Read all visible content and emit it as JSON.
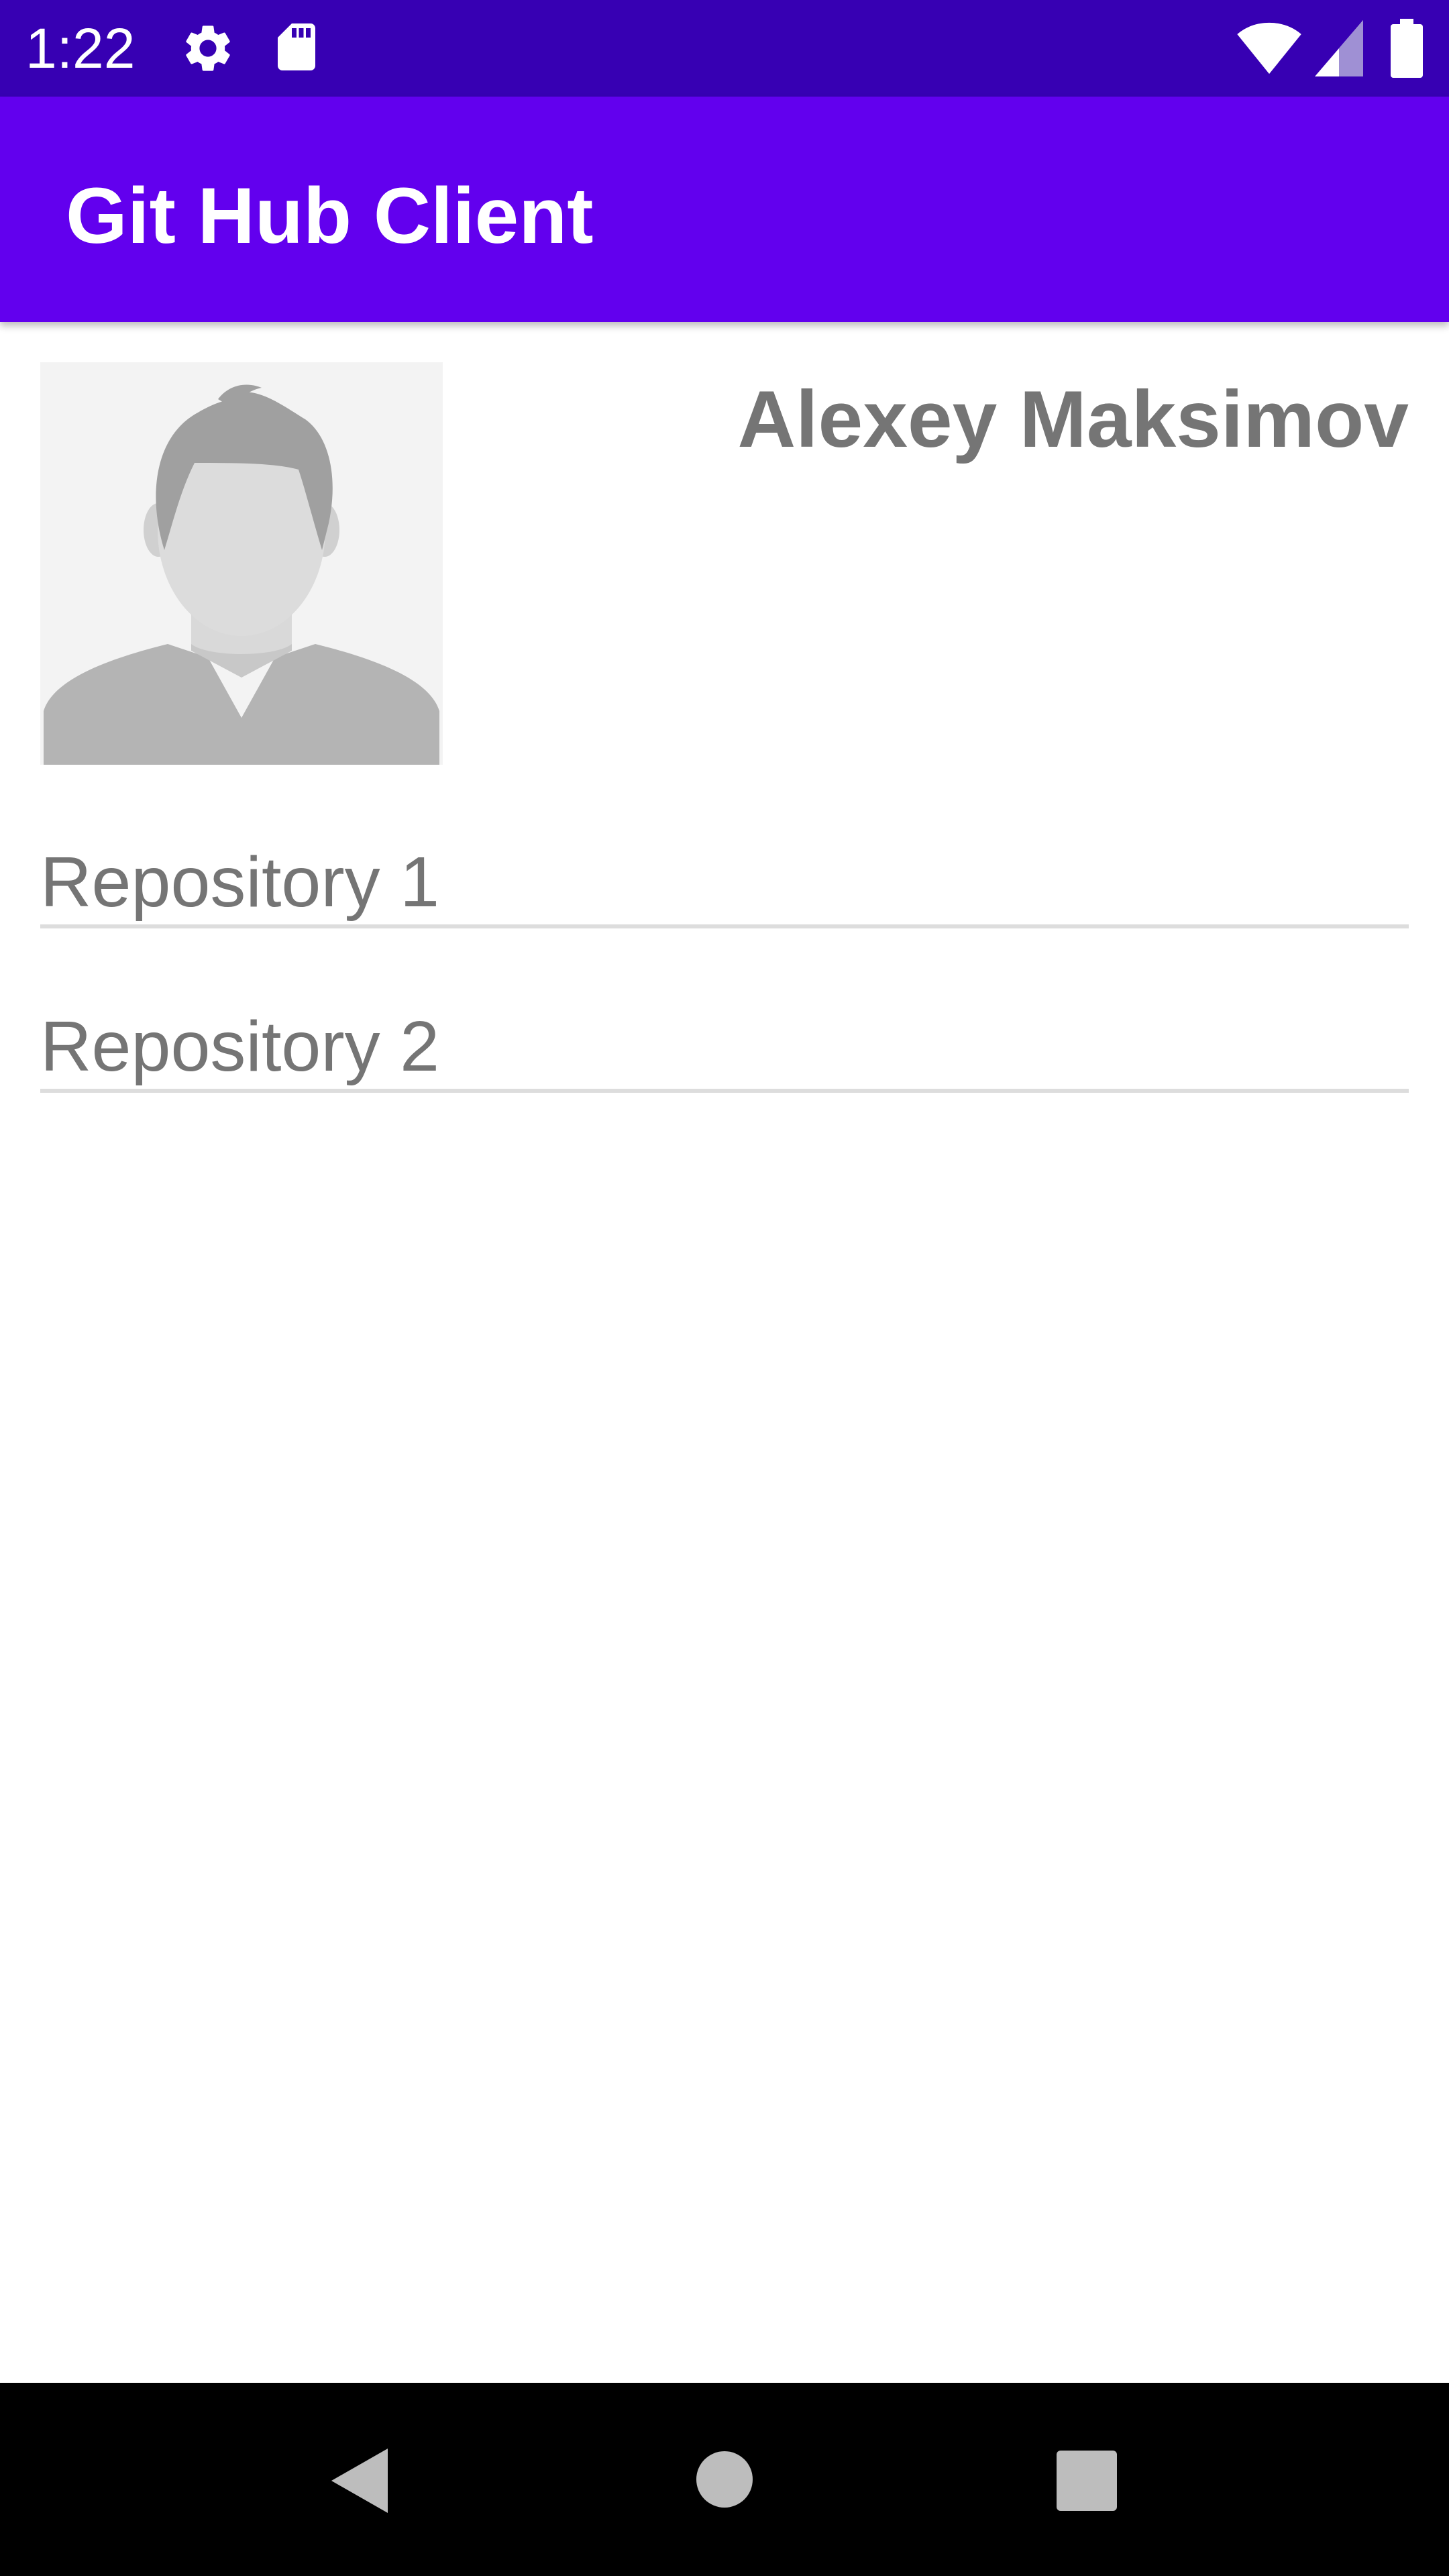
{
  "status_bar": {
    "time": "1:22",
    "icons": [
      "gear-icon",
      "sd-card-icon",
      "wifi-icon",
      "cell-signal-icon",
      "battery-icon"
    ],
    "background": "#3700b3"
  },
  "app_bar": {
    "title": "Git Hub Client",
    "background": "#6200ee"
  },
  "profile": {
    "avatar": "avatar-placeholder-icon",
    "name": "Alexey Maksimov"
  },
  "repositories": [
    {
      "name": "Repository 1"
    },
    {
      "name": "Repository 2"
    }
  ],
  "nav_bar": {
    "buttons": [
      "back-icon",
      "home-icon",
      "recents-icon"
    ]
  },
  "colors": {
    "primary": "#6200ee",
    "primary_dark": "#3700b3",
    "text_secondary": "#757575",
    "divider": "#dddddd"
  }
}
